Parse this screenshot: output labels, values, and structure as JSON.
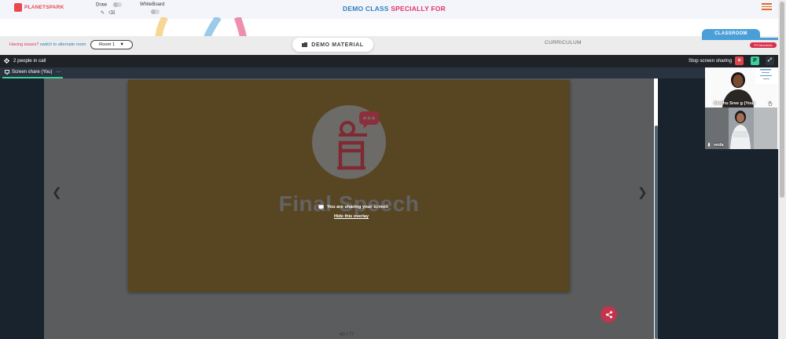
{
  "header": {
    "logo_text": "PLANETSPARK",
    "draw_label": "Draw",
    "whiteboard_label": "WhiteBoard",
    "title_part1": "DEMO CLASS",
    "title_part2": "SPECIALLY FOR"
  },
  "roombar": {
    "issues_text": "Having issues?",
    "switch_link": "switch to alternate room",
    "room_value": "Room 1",
    "demo_material": "DEMO MATERIAL",
    "curriculum": "CURRICULUM",
    "classroom_tab": "CLASSROOM",
    "pd_badge": "PS Moments"
  },
  "callbar": {
    "people_count": "2 people in call",
    "stop_sharing": "Stop screen sharing",
    "close_glyph": "×",
    "p_label": "P",
    "expand_glyph": "⤢"
  },
  "stage": {
    "tab_label": "Screen share (You)",
    "tab_more": "···",
    "slide_title": "Final Speech",
    "overlay_message": "You are sharing your screen",
    "overlay_link": "Hide this overlay",
    "prev_glyph": "❮",
    "next_glyph": "❯",
    "page_indicator": "40 / 77"
  },
  "participants": [
    {
      "name": "Sindhu Sree g (You)"
    },
    {
      "name": "veda"
    }
  ],
  "colors": {
    "brand_red": "#e8484b",
    "title_blue": "#2f7fc1",
    "title_pink": "#e0346a",
    "classroom_blue": "#4a9fd8",
    "slide_bg": "#584623",
    "fab": "#c5344d"
  }
}
